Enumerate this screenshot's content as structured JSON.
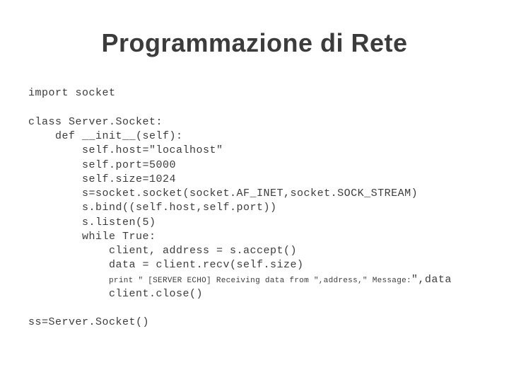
{
  "title": "Programmazione di Rete",
  "code": {
    "l01": "import socket",
    "l02": "",
    "l03": "class Server.Socket:",
    "l04": "    def __init__(self):",
    "l05": "        self.host=\"localhost\"",
    "l06": "        self.port=5000",
    "l07": "        self.size=1024",
    "l08": "        s=socket.socket(socket.AF_INET,socket.SOCK_STREAM)",
    "l09": "        s.bind((self.host,self.port))",
    "l10": "        s.listen(5)",
    "l11": "        while True:",
    "l12": "            client, address = s.accept()",
    "l13": "            data = client.recv(self.size)",
    "l14a": "            ",
    "l14b": "print \" [SERVER ECHO] Receiving data from \",address,\" Message:",
    "l14c": "\",data",
    "l15": "            client.close()",
    "l16": "",
    "l17": "ss=Server.Socket()"
  }
}
